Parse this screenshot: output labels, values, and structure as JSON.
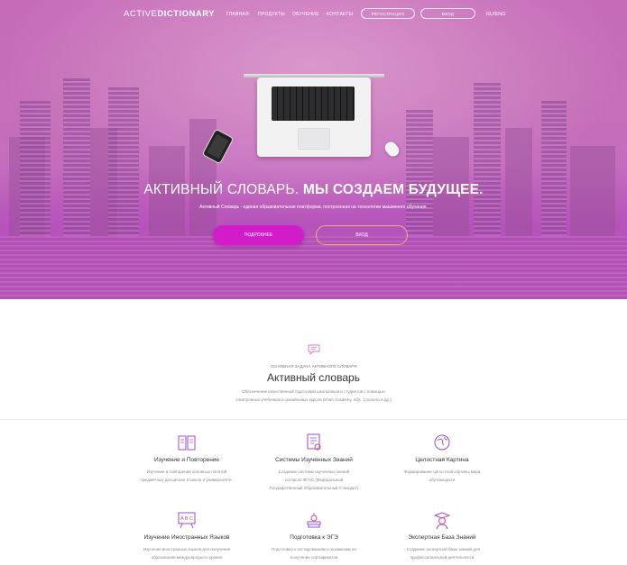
{
  "header": {
    "logo_light": "ACTIVE",
    "logo_bold": "DICTIONARY",
    "nav": [
      "ГЛАВНАЯ",
      "ПРОДУКТЫ",
      "ОБУЧЕНИЕ",
      "КОНТАКТЫ"
    ],
    "register_label": "РЕГИСТРАЦИЯ",
    "login_label": "ВХОД",
    "lang": "RU/ENG"
  },
  "hero": {
    "headline_light": "АКТИВНЫЙ СЛОВАРЬ.",
    "headline_bold": "МЫ СОЗДАЕМ БУДУЩЕЕ.",
    "subtitle": "Активный Словарь - единая образовательная платформа, построенная на технологии машинного обучения.",
    "more_button": "ПОДРОБНЕЕ",
    "login_button": "ВХОД",
    "colors": {
      "overlay": "#c56bb8",
      "primary_button": "#d21bc9",
      "outline_button": "#e8b07a"
    }
  },
  "section": {
    "icon": "chat-bubble-icon",
    "kicker": "ОСНОВНАЯ ЗАДАЧА АКТИВНОГО СЛОВАРЯ",
    "title": "Активный словарь",
    "description": "Обеспечение качественной подготовки школьников и студентов с помощью\nэлектронных учебников и онлайновых курсов (Khan Academy, edX, Coursera и др.)"
  },
  "features": [
    {
      "icon": "book-icon",
      "title": "Изучение и Повторение",
      "text": "Изучение и повторение основных понятий\nпредметных дисциплин в школе и университете."
    },
    {
      "icon": "certificate-icon",
      "title": "Системы Изученных Знаний",
      "text": "Создание системы изученных знаний\nсогласно ФГОС (Федеральный\nГосударственный Образовательный Стандарт)"
    },
    {
      "icon": "globe-icon",
      "title": "Целостная Картина",
      "text": "Формирование целостной картины мира\nобучающихся"
    },
    {
      "icon": "abc-board-icon",
      "title": "Изучение Иностранных Языков",
      "text": "Изучение иностранных языков для получения\nобразования международного уровня"
    },
    {
      "icon": "books-apple-icon",
      "title": "Подготовка к ЭГЭ",
      "text": "Подготовка к тестированиям и экзаменам на\nполучение сертификатов"
    },
    {
      "icon": "graduate-icon",
      "title": "Экспертная База Знаний",
      "text": "- Создание экспертной базы знаний для\nпрофессиональной деятельности"
    }
  ],
  "accent_color": "#c03fc5"
}
